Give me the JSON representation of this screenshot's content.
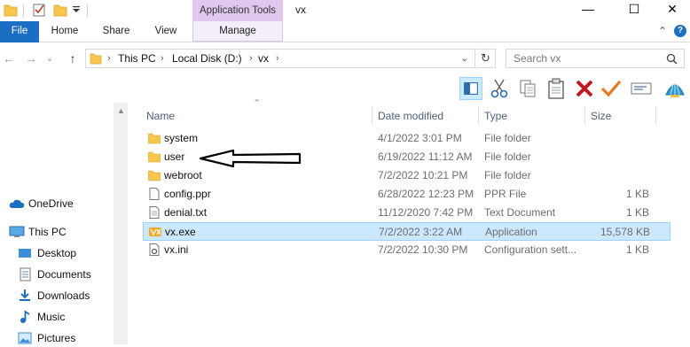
{
  "window": {
    "title": "vx",
    "minimize_glyph": "—",
    "maximize_glyph": "☐",
    "close_glyph": "✕",
    "help_glyph": "?",
    "collapse_glyph": "⌃"
  },
  "ribbon": {
    "contextual_group": "Application Tools",
    "tabs": [
      "File",
      "Home",
      "Share",
      "View",
      "Manage"
    ]
  },
  "address": {
    "back_glyph": "←",
    "forward_glyph": "→",
    "recent_glyph": "⌄",
    "up_glyph": "↑",
    "breadcrumbs": [
      "This PC",
      "Local Disk (D:)",
      "vx"
    ],
    "separator": "›",
    "refresh_glyph": "↻",
    "search_placeholder": "Search vx"
  },
  "toolbar_icons": [
    "preview-pane-icon",
    "cut-icon",
    "copy-icon",
    "paste-icon",
    "delete-icon",
    "checkmark-icon",
    "rename-icon",
    "shell-icon"
  ],
  "navigation": {
    "items": [
      {
        "label": "OneDrive",
        "icon": "cloud-icon"
      },
      {
        "label": "This PC",
        "icon": "computer-icon"
      },
      {
        "label": "Desktop",
        "icon": "desktop-icon"
      },
      {
        "label": "Documents",
        "icon": "documents-icon"
      },
      {
        "label": "Downloads",
        "icon": "downloads-icon"
      },
      {
        "label": "Music",
        "icon": "music-icon"
      },
      {
        "label": "Pictures",
        "icon": "pictures-icon"
      }
    ]
  },
  "file_list": {
    "columns": [
      "Name",
      "Date modified",
      "Type",
      "Size"
    ],
    "sort_glyph": "⌃",
    "rows": [
      {
        "name": "system",
        "date": "4/1/2022 3:01 PM",
        "type": "File folder",
        "size": "",
        "icon": "folder-icon"
      },
      {
        "name": "user",
        "date": "6/19/2022 11:12 AM",
        "type": "File folder",
        "size": "",
        "icon": "folder-icon"
      },
      {
        "name": "webroot",
        "date": "7/2/2022 10:21 PM",
        "type": "File folder",
        "size": "",
        "icon": "folder-icon"
      },
      {
        "name": "config.ppr",
        "date": "6/28/2022 12:23 PM",
        "type": "PPR File",
        "size": "1 KB",
        "icon": "file-icon"
      },
      {
        "name": "denial.txt",
        "date": "11/12/2020 7:42 PM",
        "type": "Text Document",
        "size": "1 KB",
        "icon": "text-file-icon"
      },
      {
        "name": "vx.exe",
        "date": "7/2/2022 3:22 AM",
        "type": "Application",
        "size": "15,578 KB",
        "icon": "app-icon",
        "selected": true
      },
      {
        "name": "vx.ini",
        "date": "7/2/2022 10:30 PM",
        "type": "Configuration sett...",
        "size": "1 KB",
        "icon": "config-file-icon"
      }
    ]
  },
  "colors": {
    "file_tab": "#1a6fc4",
    "contextual_tab": "#dfc8ee",
    "selection_bg": "#cce8ff",
    "selection_border": "#99d1ff",
    "folder": "#f6c74b"
  }
}
